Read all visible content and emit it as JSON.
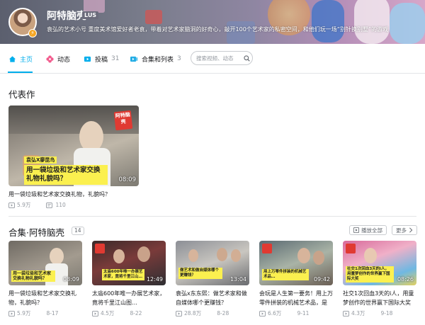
{
  "profile": {
    "name": "阿特脑壳",
    "level": "LUS",
    "bio": "袁弘的艺术小号 重度美术馆爱好者老袁，带着对艺术家脑洞的好奇心，敲开100个艺术家的私密空间，和他们玩一场“别针换别墅”的游戏"
  },
  "nav": {
    "tabs": [
      {
        "label": "主页",
        "count": "",
        "active": true
      },
      {
        "label": "动态",
        "count": ""
      },
      {
        "label": "投稿",
        "count": "31"
      },
      {
        "label": "合集和列表",
        "count": "3"
      }
    ],
    "search_placeholder": "搜索视频、动态"
  },
  "featured": {
    "section_title": "代表作",
    "video": {
      "title": "用一袋垃圾和艺术家交换礼物，礼貌吗？",
      "duration": "08:09",
      "views": "5.9万",
      "danmaku": "110",
      "cover_tag": "袁弘X廖昆鸟",
      "cover_caption": "用一袋垃圾和艺术家交换礼物礼貌吗？",
      "stamp": "阿特脑壳"
    }
  },
  "collection": {
    "title": "合集·阿特脑壳",
    "count": "14",
    "play_all": "播放全部",
    "more": "更多",
    "videos": [
      {
        "title": "用一袋垃圾和艺术家交换礼物，礼貌吗？",
        "duration": "08:09",
        "views": "5.9万",
        "date": "8-17",
        "cover_caption": "用一袋垃圾和艺术家交换礼物礼貌吗？"
      },
      {
        "title": "太庙600年唯一办展艺术家，竟将千里江山图…",
        "duration": "12:49",
        "views": "4.5万",
        "date": "8-22",
        "cover_caption": "太庙600年唯一办展艺术家，竟将千里江山…"
      },
      {
        "title": "袁弘x东东熙：做艺术家和做自媒体哪个更赚钱？",
        "duration": "13:04",
        "views": "28.8万",
        "date": "8-28",
        "cover_caption": "做艺术和做自媒体哪个更赚钱？"
      },
      {
        "title": "会玩是人生第一要务！用上万零件拼装的机械艺术品，是他…",
        "duration": "09:42",
        "views": "6.6万",
        "date": "9-11",
        "cover_caption": "用上万零件拼装的机械艺术品…"
      },
      {
        "title": "社交1次回血3天的i人，用童梦创作的世界赢下国际大奖",
        "duration": "08:26",
        "views": "4.3万",
        "date": "9-18",
        "cover_caption": "社交1次回血3天的i人，用童梦创作的世界赢下国际大奖"
      }
    ]
  },
  "colors": {
    "accent": "#00aeec",
    "text_main": "#18191c",
    "text_muted": "#9499a0",
    "caption_yellow": "#fbf04f",
    "stamp_red": "#e03a32"
  },
  "icons": [
    "home-icon",
    "flower-icon",
    "upload-icon",
    "collection-icon",
    "search-icon",
    "play-count-icon",
    "danmaku-icon",
    "play-all-icon",
    "chevron-right-icon"
  ]
}
